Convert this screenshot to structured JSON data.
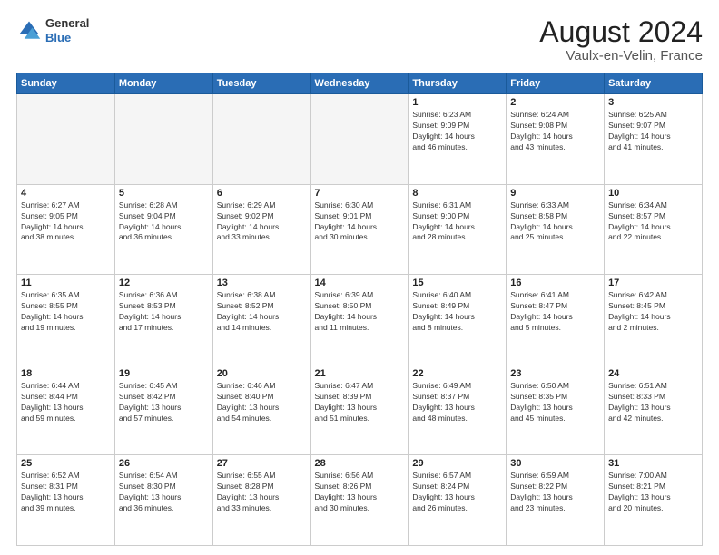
{
  "logo": {
    "general": "General",
    "blue": "Blue"
  },
  "header": {
    "month": "August 2024",
    "location": "Vaulx-en-Velin, France"
  },
  "weekdays": [
    "Sunday",
    "Monday",
    "Tuesday",
    "Wednesday",
    "Thursday",
    "Friday",
    "Saturday"
  ],
  "weeks": [
    [
      {
        "day": "",
        "empty": true
      },
      {
        "day": "",
        "empty": true
      },
      {
        "day": "",
        "empty": true
      },
      {
        "day": "",
        "empty": true
      },
      {
        "day": "1",
        "info": "Sunrise: 6:23 AM\nSunset: 9:09 PM\nDaylight: 14 hours\nand 46 minutes."
      },
      {
        "day": "2",
        "info": "Sunrise: 6:24 AM\nSunset: 9:08 PM\nDaylight: 14 hours\nand 43 minutes."
      },
      {
        "day": "3",
        "info": "Sunrise: 6:25 AM\nSunset: 9:07 PM\nDaylight: 14 hours\nand 41 minutes."
      }
    ],
    [
      {
        "day": "4",
        "info": "Sunrise: 6:27 AM\nSunset: 9:05 PM\nDaylight: 14 hours\nand 38 minutes."
      },
      {
        "day": "5",
        "info": "Sunrise: 6:28 AM\nSunset: 9:04 PM\nDaylight: 14 hours\nand 36 minutes."
      },
      {
        "day": "6",
        "info": "Sunrise: 6:29 AM\nSunset: 9:02 PM\nDaylight: 14 hours\nand 33 minutes."
      },
      {
        "day": "7",
        "info": "Sunrise: 6:30 AM\nSunset: 9:01 PM\nDaylight: 14 hours\nand 30 minutes."
      },
      {
        "day": "8",
        "info": "Sunrise: 6:31 AM\nSunset: 9:00 PM\nDaylight: 14 hours\nand 28 minutes."
      },
      {
        "day": "9",
        "info": "Sunrise: 6:33 AM\nSunset: 8:58 PM\nDaylight: 14 hours\nand 25 minutes."
      },
      {
        "day": "10",
        "info": "Sunrise: 6:34 AM\nSunset: 8:57 PM\nDaylight: 14 hours\nand 22 minutes."
      }
    ],
    [
      {
        "day": "11",
        "info": "Sunrise: 6:35 AM\nSunset: 8:55 PM\nDaylight: 14 hours\nand 19 minutes."
      },
      {
        "day": "12",
        "info": "Sunrise: 6:36 AM\nSunset: 8:53 PM\nDaylight: 14 hours\nand 17 minutes."
      },
      {
        "day": "13",
        "info": "Sunrise: 6:38 AM\nSunset: 8:52 PM\nDaylight: 14 hours\nand 14 minutes."
      },
      {
        "day": "14",
        "info": "Sunrise: 6:39 AM\nSunset: 8:50 PM\nDaylight: 14 hours\nand 11 minutes."
      },
      {
        "day": "15",
        "info": "Sunrise: 6:40 AM\nSunset: 8:49 PM\nDaylight: 14 hours\nand 8 minutes."
      },
      {
        "day": "16",
        "info": "Sunrise: 6:41 AM\nSunset: 8:47 PM\nDaylight: 14 hours\nand 5 minutes."
      },
      {
        "day": "17",
        "info": "Sunrise: 6:42 AM\nSunset: 8:45 PM\nDaylight: 14 hours\nand 2 minutes."
      }
    ],
    [
      {
        "day": "18",
        "info": "Sunrise: 6:44 AM\nSunset: 8:44 PM\nDaylight: 13 hours\nand 59 minutes."
      },
      {
        "day": "19",
        "info": "Sunrise: 6:45 AM\nSunset: 8:42 PM\nDaylight: 13 hours\nand 57 minutes."
      },
      {
        "day": "20",
        "info": "Sunrise: 6:46 AM\nSunset: 8:40 PM\nDaylight: 13 hours\nand 54 minutes."
      },
      {
        "day": "21",
        "info": "Sunrise: 6:47 AM\nSunset: 8:39 PM\nDaylight: 13 hours\nand 51 minutes."
      },
      {
        "day": "22",
        "info": "Sunrise: 6:49 AM\nSunset: 8:37 PM\nDaylight: 13 hours\nand 48 minutes."
      },
      {
        "day": "23",
        "info": "Sunrise: 6:50 AM\nSunset: 8:35 PM\nDaylight: 13 hours\nand 45 minutes."
      },
      {
        "day": "24",
        "info": "Sunrise: 6:51 AM\nSunset: 8:33 PM\nDaylight: 13 hours\nand 42 minutes."
      }
    ],
    [
      {
        "day": "25",
        "info": "Sunrise: 6:52 AM\nSunset: 8:31 PM\nDaylight: 13 hours\nand 39 minutes."
      },
      {
        "day": "26",
        "info": "Sunrise: 6:54 AM\nSunset: 8:30 PM\nDaylight: 13 hours\nand 36 minutes."
      },
      {
        "day": "27",
        "info": "Sunrise: 6:55 AM\nSunset: 8:28 PM\nDaylight: 13 hours\nand 33 minutes."
      },
      {
        "day": "28",
        "info": "Sunrise: 6:56 AM\nSunset: 8:26 PM\nDaylight: 13 hours\nand 30 minutes."
      },
      {
        "day": "29",
        "info": "Sunrise: 6:57 AM\nSunset: 8:24 PM\nDaylight: 13 hours\nand 26 minutes."
      },
      {
        "day": "30",
        "info": "Sunrise: 6:59 AM\nSunset: 8:22 PM\nDaylight: 13 hours\nand 23 minutes."
      },
      {
        "day": "31",
        "info": "Sunrise: 7:00 AM\nSunset: 8:21 PM\nDaylight: 13 hours\nand 20 minutes."
      }
    ]
  ]
}
